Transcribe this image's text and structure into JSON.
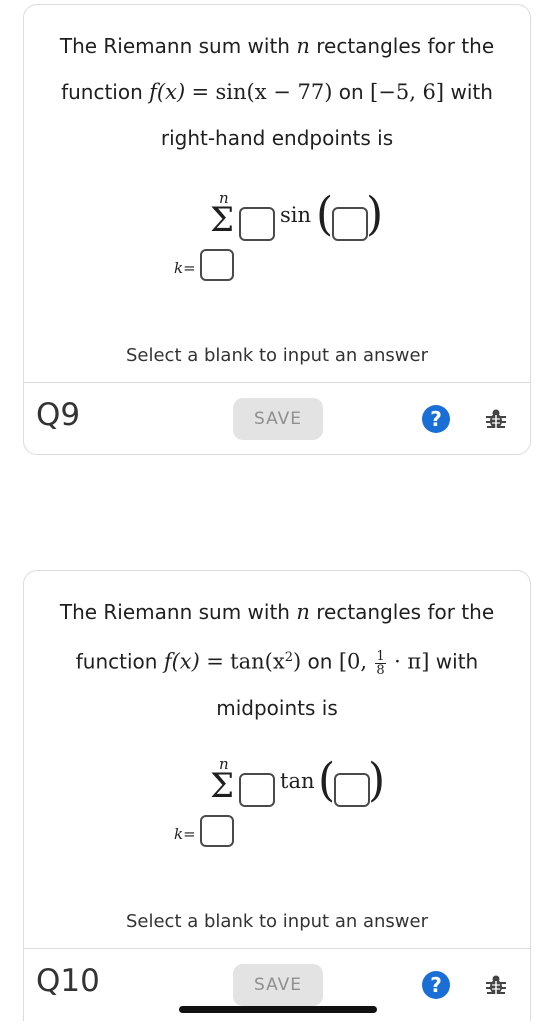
{
  "questions": [
    {
      "id": "Q9",
      "text_prefix": "The Riemann sum with",
      "var_n": "n",
      "text_mid": "rectangles for the function",
      "func_def": "f(x)",
      "equals": "=",
      "func_expr": "sin(x − 77)",
      "on_word": "on",
      "interval": "[−5, 6]",
      "with_word": "with",
      "method": "right-hand endpoints is",
      "sum_upper": "n",
      "sum_lower": "k=",
      "trig": "sin",
      "hint": "Select a blank to input an answer",
      "label": "Q9",
      "save": "SAVE",
      "help": "?"
    },
    {
      "id": "Q10",
      "text_prefix": "The Riemann sum with",
      "var_n": "n",
      "text_mid": "rectangles for the function",
      "func_def": "f(x)",
      "equals": "=",
      "func_expr_base": "tan(x",
      "func_expr_exp": "2",
      "func_expr_close": ")",
      "on_word": "on",
      "interval_open": "[0,",
      "frac_num": "1",
      "frac_den": "8",
      "interval_close": "· π]",
      "with_word": "with",
      "method": "midpoints is",
      "sum_upper": "n",
      "sum_lower": "k=",
      "trig": "tan",
      "hint": "Select a blank to input an answer",
      "label": "Q10",
      "save": "SAVE",
      "help": "?"
    }
  ],
  "colors": {
    "help_blue": "#1a6fd6",
    "save_bg": "#e3e3e3",
    "save_text": "#8f8f8f"
  }
}
